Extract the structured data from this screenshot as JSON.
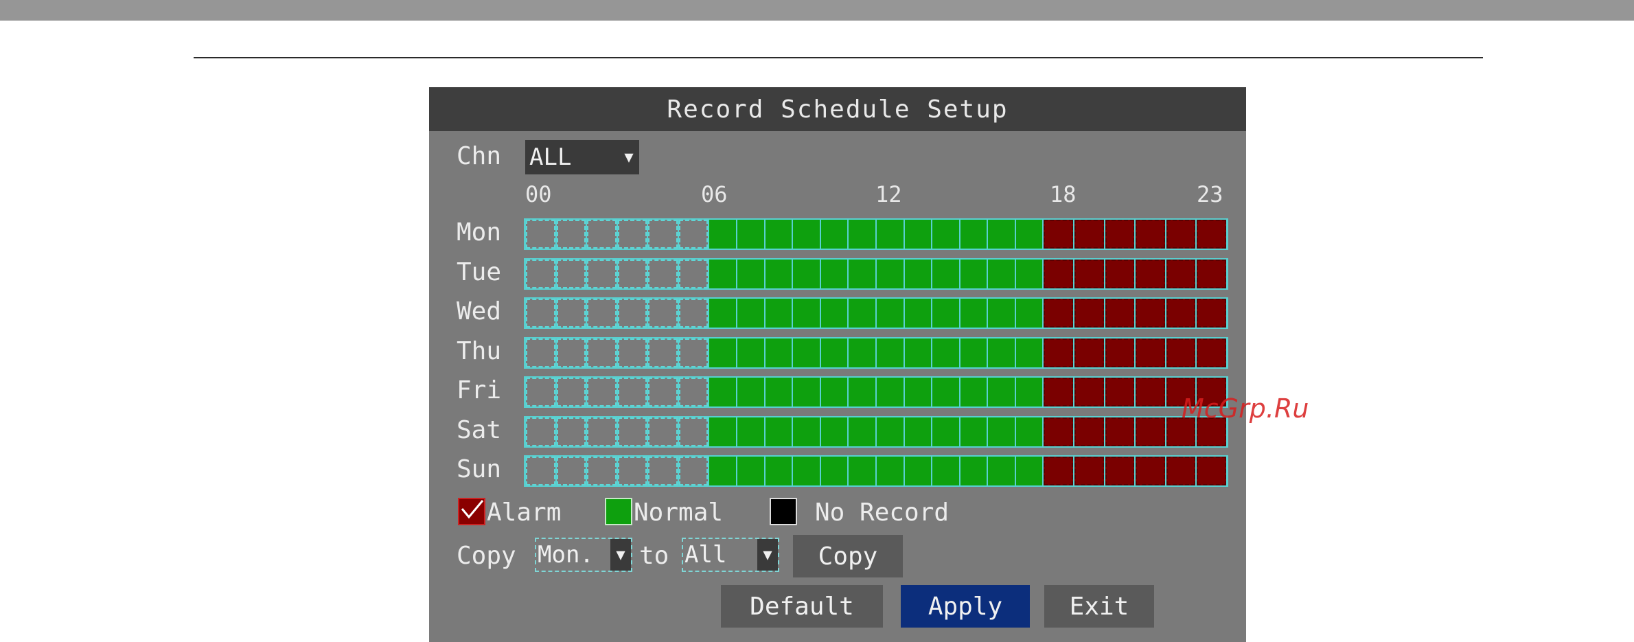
{
  "dialog": {
    "title": "Record Schedule Setup",
    "channel_label": "Chn",
    "channel_value": "ALL",
    "hour_labels": [
      "00",
      "06",
      "12",
      "18",
      "23"
    ],
    "days": [
      "Mon",
      "Tue",
      "Wed",
      "Thu",
      "Fri",
      "Sat",
      "Sun"
    ],
    "schedule_pattern": {
      "hours_no_record": "00-05",
      "hours_normal": "06-17",
      "hours_alarm": "18-23"
    },
    "legend": {
      "alarm": "Alarm",
      "normal": "Normal",
      "no_record": "No Record"
    },
    "copy": {
      "label": "Copy",
      "from": "Mon.",
      "to_label": "to",
      "to": "All",
      "button": "Copy"
    },
    "buttons": {
      "default": "Default",
      "apply": "Apply",
      "exit": "Exit"
    }
  },
  "watermark": "McGrp.Ru",
  "colors": {
    "normal": "#0ea00e",
    "alarm": "#7a0000",
    "no_record": "#000000",
    "apply_button": "#0c2e7c",
    "title_bar": "#3e3e3e"
  }
}
